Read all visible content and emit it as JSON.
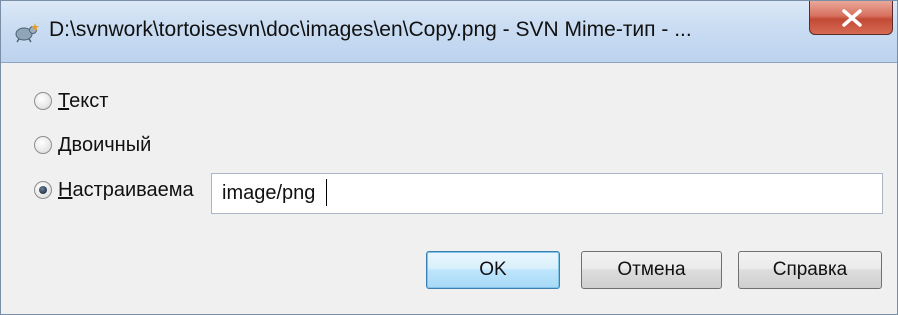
{
  "window": {
    "title": "D:\\svnwork\\tortoisesvn\\doc\\images\\en\\Copy.png - SVN Mime-тип - ...",
    "close_icon": "close-x-icon",
    "app_icon": "tortoisesvn-icon"
  },
  "options": {
    "text": {
      "accel": "Т",
      "rest": "екст",
      "checked": false
    },
    "binary": {
      "accel": "Д",
      "rest": "воичный",
      "checked": false
    },
    "custom": {
      "accel": "Н",
      "rest": "астраиваема",
      "checked": true
    }
  },
  "custom_input": {
    "value": "image/png"
  },
  "buttons": {
    "ok": "OK",
    "cancel": "Отмена",
    "help": "Справка"
  },
  "colors": {
    "titlebar": "#c9dcf2",
    "close_button": "#c24a36",
    "dialog_bg": "#f0f0f0",
    "default_button_border": "#3c7fb1"
  }
}
